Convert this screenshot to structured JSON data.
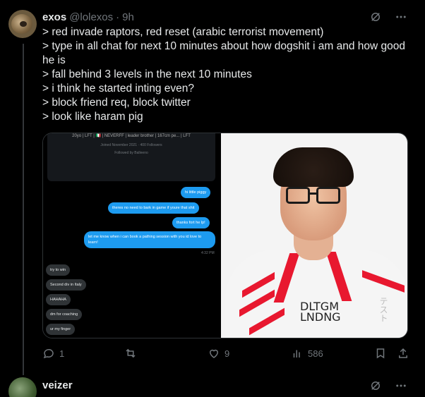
{
  "post": {
    "author_name": "exos",
    "handle": "@lolexos",
    "separator": "·",
    "time": "9h",
    "lines": [
      "> red invade raptors, red reset (arabic terrorist movement)",
      "> type in all chat for next 10 minutes about how dogshit i am and how good he is",
      "> fall behind 3 levels in the next 10 minutes",
      "> i think he started inting even?",
      "> block friend req, block twitter",
      "> look like haram pig"
    ],
    "icons": [
      "grok-icon",
      "more-icon"
    ]
  },
  "screenshot": {
    "profile_line1": "20yo | LFT | 🇮🇹 | NEVERFF | leader brother | 167cm pe... | LFT",
    "profile_line2": "Joined November 2021 · 400 Followers",
    "profile_line3": "Followed by Balleeno",
    "outgoing": [
      "hi little piggy",
      "theres no need to bark in game if youre that shit",
      "thanks fort he lp!",
      "let me know when i can book a pathing session with you id love to learn!"
    ],
    "timestamp": "4:32 PM",
    "incoming": [
      "try to win",
      "Second div in Italy",
      "HAHAHA",
      "dm for coaching",
      "ur my finger"
    ]
  },
  "photo": {
    "shirt_text_line1": "DLTGM",
    "shirt_text_line2": "LNDNG",
    "jp_text": "テスト"
  },
  "actions": {
    "replies": "1",
    "reposts": "",
    "likes": "9",
    "views": "586"
  },
  "next_post": {
    "author_name": "veizer"
  },
  "colors": {
    "background": "#000000",
    "text": "#e7e9ea",
    "muted": "#71767b",
    "accent": "#1d9bf0",
    "jersey_red": "#e8182f"
  }
}
